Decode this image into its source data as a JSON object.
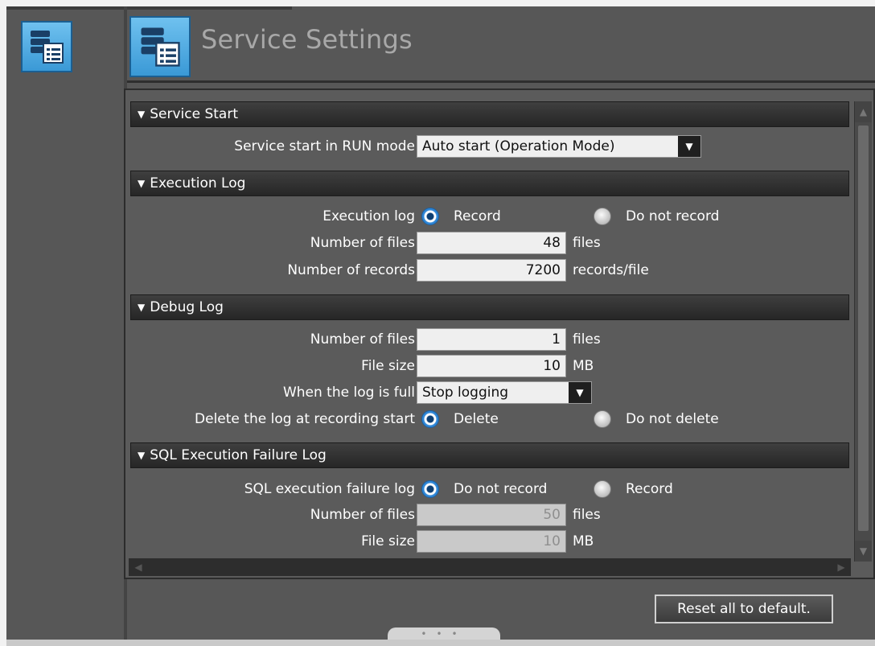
{
  "window": {
    "title": "Service Settings",
    "left_icon": "service-settings-icon",
    "title_icon": "service-settings-icon"
  },
  "sections": {
    "service_start": {
      "header": "Service Start",
      "run_mode_label": "Service start in RUN mode",
      "run_mode_value": "Auto start (Operation Mode)"
    },
    "execution_log": {
      "header": "Execution Log",
      "log_label": "Execution log",
      "opt_record": "Record",
      "opt_do_not_record": "Do not record",
      "selected": "Record",
      "files_label": "Number of files",
      "files_value": "48",
      "files_unit": "files",
      "records_label": "Number of records",
      "records_value": "7200",
      "records_unit": "records/file"
    },
    "debug_log": {
      "header": "Debug Log",
      "files_label": "Number of files",
      "files_value": "1",
      "files_unit": "files",
      "size_label": "File size",
      "size_value": "10",
      "size_unit": "MB",
      "full_label": "When the log is full",
      "full_value": "Stop logging",
      "delete_label": "Delete the log at recording start",
      "opt_delete": "Delete",
      "opt_do_not_delete": "Do not delete",
      "selected": "Delete"
    },
    "sql_failure_log": {
      "header": "SQL Execution Failure Log",
      "log_label": "SQL execution failure log",
      "opt_do_not_record": "Do not record",
      "opt_record": "Record",
      "selected": "Do not record",
      "files_label": "Number of files",
      "files_value": "50",
      "files_unit": "files",
      "size_label": "File size",
      "size_value": "10",
      "size_unit": "MB"
    }
  },
  "footer": {
    "reset_label": "Reset all to default."
  },
  "colors": {
    "panel_bg": "#575757",
    "header_bg": "#262626",
    "radio_selected": "#2e86d6",
    "icon_blue": "#3a99d6"
  }
}
